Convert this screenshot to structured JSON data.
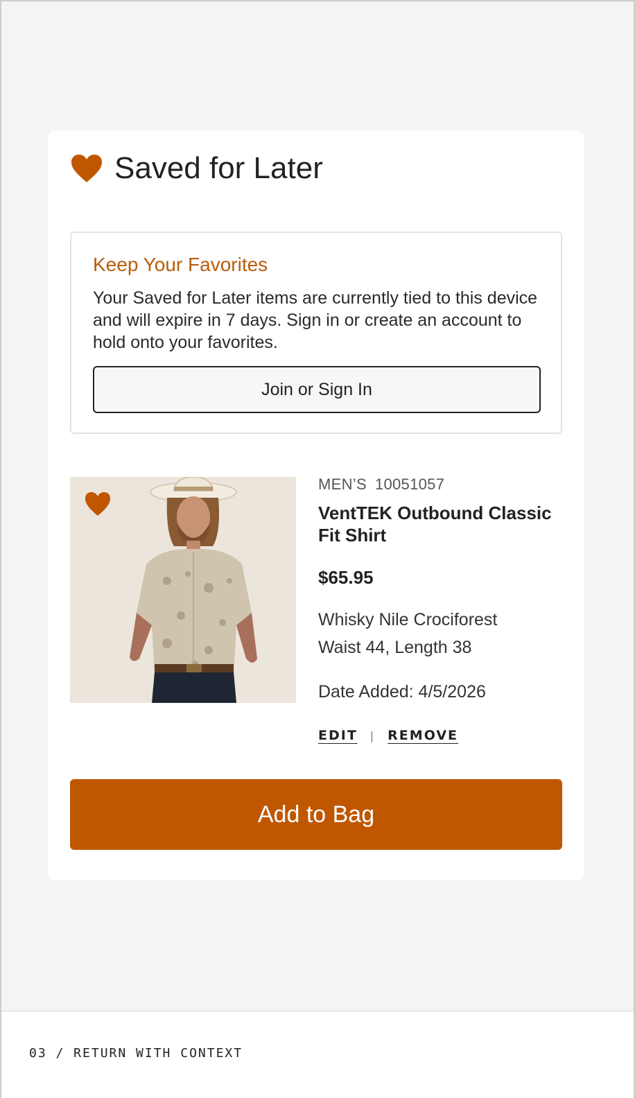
{
  "section": {
    "title": "Saved for Later"
  },
  "notice": {
    "title": "Keep Your Favorites",
    "body": "Your Saved for Later items are currently tied to this device and will expire in 7 days. Sign in or create an account to hold onto your favorites.",
    "button_label": "Join or Sign In"
  },
  "product": {
    "category": "MEN’S",
    "sku": "10051057",
    "name": "VentTEK Outbound Classic Fit Shirt",
    "price": "$65.95",
    "color": "Whisky Nile Crociforest",
    "size": "Waist 44, Length 38",
    "date_added": "Date Added: 4/5/2026",
    "favorited_icon": "heart-icon"
  },
  "actions": {
    "edit_label": "EDIT",
    "separator": "|",
    "remove_label": "REMOVE"
  },
  "cta": {
    "add_to_bag_label": "Add to Bag"
  },
  "footer": {
    "label": "03 / RETURN WITH CONTEXT"
  },
  "colors": {
    "accent": "#bf5700",
    "notice_title": "#b85c09",
    "text": "#222222",
    "background": "#f3f4f3"
  }
}
